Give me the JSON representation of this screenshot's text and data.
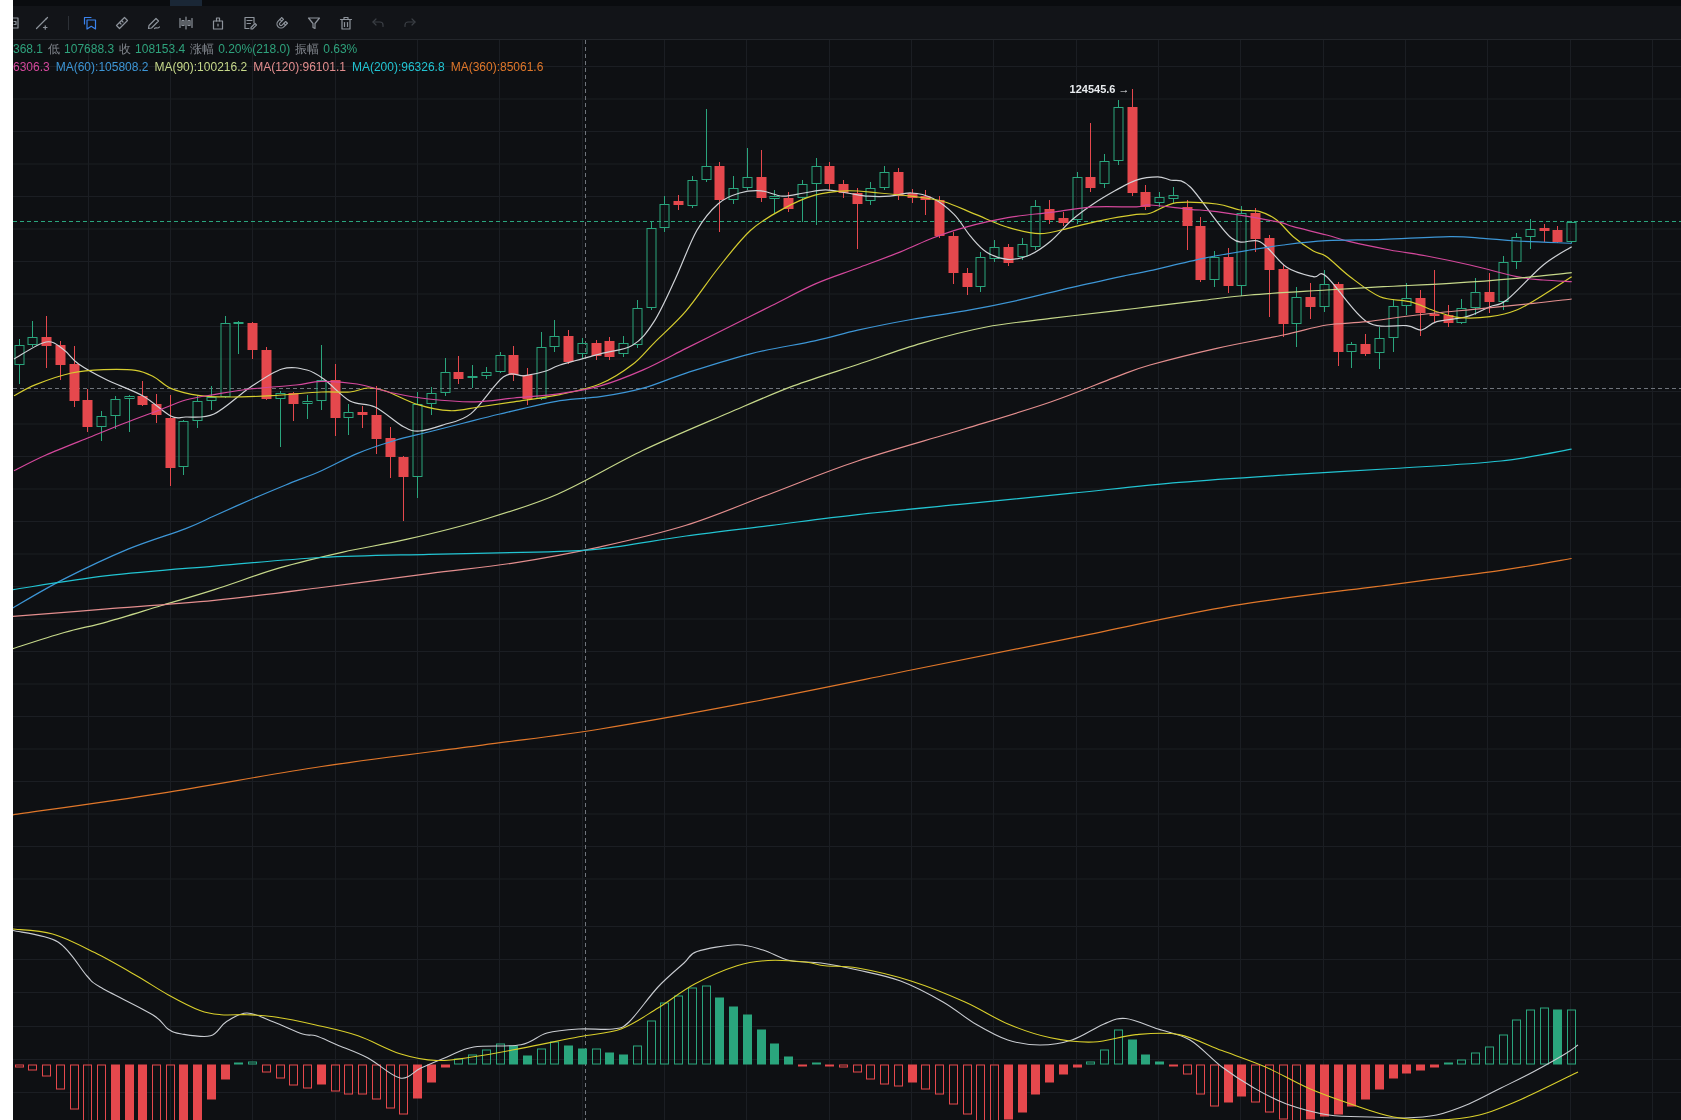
{
  "toolbar": {
    "groups": [
      [
        {
          "kind": "clipped",
          "selected": false,
          "disabled": false
        },
        {
          "kind": "line",
          "selected": false,
          "disabled": false
        }
      ],
      [
        {
          "kind": "bookmark",
          "selected": true,
          "disabled": false
        },
        {
          "kind": "ruler",
          "selected": false,
          "disabled": false
        },
        {
          "kind": "pen",
          "selected": false,
          "disabled": false
        },
        {
          "kind": "bars",
          "selected": false,
          "disabled": false
        },
        {
          "kind": "lock",
          "selected": false,
          "disabled": false
        },
        {
          "kind": "note",
          "selected": false,
          "disabled": false
        },
        {
          "kind": "magnet",
          "selected": false,
          "disabled": false
        },
        {
          "kind": "filter",
          "selected": false,
          "disabled": false
        },
        {
          "kind": "trash",
          "selected": false,
          "disabled": false
        },
        {
          "kind": "undo",
          "selected": false,
          "disabled": true
        },
        {
          "kind": "redo",
          "selected": false,
          "disabled": true
        }
      ]
    ]
  },
  "legend": {
    "stats": [
      {
        "value": "368.1"
      },
      {
        "label": "低",
        "value": "107688.3"
      },
      {
        "label": "收",
        "value": "108153.4"
      },
      {
        "label": "涨幅",
        "value": "0.20%(218.0)"
      },
      {
        "label": "振幅",
        "value": "0.63%"
      }
    ],
    "moving_averages": [
      {
        "text": "6306.3",
        "color": "#d4489c"
      },
      {
        "text": "MA(60):105808.2",
        "color": "#3d96d6"
      },
      {
        "text": "MA(90):100216.2",
        "color": "#c6d88a"
      },
      {
        "text": "MA(120):96101.1",
        "color": "#e38e8e"
      },
      {
        "text": "MA(200):96326.8",
        "color": "#22c4d2"
      },
      {
        "text": "MA(360):85061.6",
        "color": "#e0772a"
      }
    ]
  },
  "chart": {
    "high_label": "124545.6 →"
  }
}
